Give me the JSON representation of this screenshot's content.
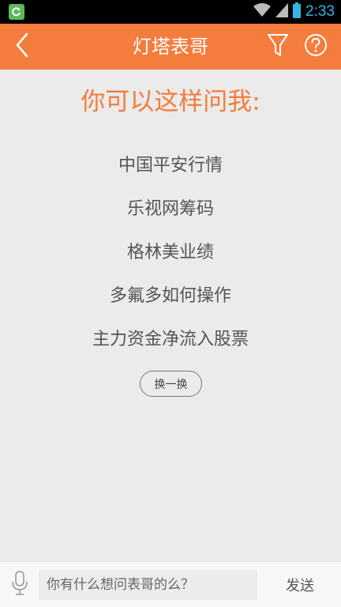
{
  "status_bar": {
    "time": "2:33",
    "icons": [
      "app-notification-icon",
      "wifi-icon",
      "signal-icon",
      "battery-icon"
    ]
  },
  "header": {
    "title": "灯塔表哥",
    "icons": [
      "back-arrow-icon",
      "filter-funnel-icon",
      "help-question-icon"
    ]
  },
  "main": {
    "prompt": "你可以这样问我:",
    "suggestions": [
      "中国平安行情",
      "乐视网筹码",
      "格林美业绩",
      "多氟多如何操作",
      "主力资金净流入股票"
    ],
    "refresh_label": "换一换"
  },
  "input_bar": {
    "placeholder": "你有什么想问表哥的么？",
    "value": "",
    "send_label": "发送",
    "icons": [
      "microphone-icon"
    ]
  },
  "colors": {
    "accent": "#f47c3c",
    "background": "#ebebeb",
    "status_bar": "#000000",
    "clock": "#33b5e5"
  }
}
